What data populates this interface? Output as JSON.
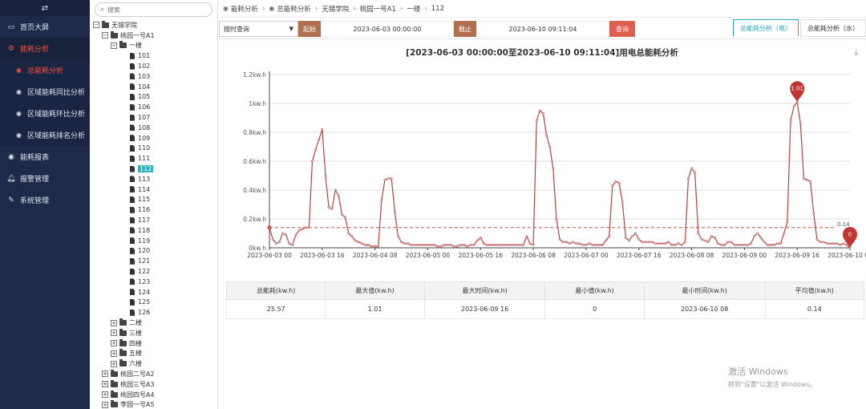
{
  "nav": {
    "items": [
      {
        "label": "首页大屏",
        "icon": "monitor-icon"
      },
      {
        "label": "能耗分析",
        "icon": "gear-icon",
        "active": true,
        "children": [
          {
            "label": "总能耗分析",
            "active": true
          },
          {
            "label": "区域能耗同比分析"
          },
          {
            "label": "区域能耗环比分析"
          },
          {
            "label": "区域能耗排名分析"
          }
        ]
      },
      {
        "label": "能耗报表",
        "icon": "pin-icon"
      },
      {
        "label": "报警管理",
        "icon": "bell-icon"
      },
      {
        "label": "系统管理",
        "icon": "wrench-icon"
      }
    ]
  },
  "tree": {
    "search_placeholder": "搜索",
    "root": "无锡学院",
    "campus": "桃园一号A1",
    "floor1": "一楼",
    "rooms": [
      "101",
      "102",
      "103",
      "104",
      "105",
      "106",
      "107",
      "108",
      "109",
      "110",
      "111",
      "112",
      "113",
      "114",
      "115",
      "116",
      "117",
      "118",
      "119",
      "120",
      "121",
      "122",
      "123",
      "124",
      "125",
      "126"
    ],
    "selected_room": "112",
    "other_floors": [
      "二楼",
      "三楼",
      "四楼",
      "五楼",
      "六楼"
    ],
    "other_buildings": [
      "桃园二号A2",
      "桃园三号A3",
      "桃园四号A4",
      "李园一号A5"
    ]
  },
  "breadcrumb": [
    "能耗分析",
    "总能耗分析",
    "无锡学院",
    "桃园一号A1",
    "一楼",
    "112"
  ],
  "toolbar": {
    "mode": "按时查询",
    "start_label": "起始",
    "start_value": "2023-06-03 00:00:00",
    "end_label": "截止",
    "end_value": "2023-06-10 09:11:04",
    "query_label": "查询",
    "tabs": [
      "总能耗分析（电）",
      "总能耗分析（水）"
    ]
  },
  "colors": {
    "line": "#b8403e",
    "marker": "#c23531",
    "accent": "#2ba3b8",
    "nav_bg": "#1e2a4a"
  },
  "chart_data": {
    "type": "line",
    "title": "[2023-06-03 00:00:00至2023-06-10 09:11:04]用电总能耗分析",
    "y_ticks": [
      "0kw.h",
      "0.2kw.h",
      "0.4kw.h",
      "0.6kw.h",
      "0.8kw.h",
      "1kw.h",
      "1.2kw.h"
    ],
    "ylim": [
      0,
      1.2
    ],
    "x_ticks": [
      "2023-06-03 00",
      "2023-06-03 16",
      "2023-06-04 08",
      "2023-06-05 00",
      "2023-06-05 16",
      "2023-06-06 08",
      "2023-06-07 00",
      "2023-06-07 16",
      "2023-06-08 08",
      "2023-06-09 00",
      "2023-06-09 16",
      "2023-06-10 08"
    ],
    "x_tick_hours": [
      0,
      16,
      32,
      48,
      64,
      80,
      96,
      112,
      128,
      144,
      160,
      176
    ],
    "average": 0.14,
    "average_label": "0.14",
    "max_pin": {
      "label": "1.01",
      "hour": 160,
      "value": 1.01
    },
    "min_pin": {
      "label": "0",
      "hour": 176,
      "value": 0
    },
    "points": [
      [
        0,
        0.14
      ],
      [
        1,
        0.06
      ],
      [
        2,
        0.03
      ],
      [
        3,
        0.04
      ],
      [
        4,
        0.1
      ],
      [
        5,
        0.09
      ],
      [
        6,
        0.03
      ],
      [
        7,
        0.02
      ],
      [
        8,
        0.09
      ],
      [
        9,
        0.12
      ],
      [
        10,
        0.13
      ],
      [
        11,
        0.14
      ],
      [
        12,
        0.14
      ],
      [
        13,
        0.6
      ],
      [
        14,
        0.68
      ],
      [
        15,
        0.75
      ],
      [
        16,
        0.82
      ],
      [
        17,
        0.5
      ],
      [
        18,
        0.28
      ],
      [
        19,
        0.27
      ],
      [
        20,
        0.4
      ],
      [
        21,
        0.36
      ],
      [
        22,
        0.23
      ],
      [
        23,
        0.21
      ],
      [
        24,
        0.1
      ],
      [
        25,
        0.08
      ],
      [
        26,
        0.05
      ],
      [
        27,
        0.04
      ],
      [
        28,
        0.03
      ],
      [
        29,
        0.02
      ],
      [
        30,
        0.02
      ],
      [
        31,
        0.01
      ],
      [
        32,
        0.01
      ],
      [
        33,
        0.01
      ],
      [
        34,
        0.33
      ],
      [
        35,
        0.47
      ],
      [
        36,
        0.48
      ],
      [
        37,
        0.48
      ],
      [
        38,
        0.25
      ],
      [
        39,
        0.08
      ],
      [
        40,
        0.04
      ],
      [
        41,
        0.03
      ],
      [
        42,
        0.03
      ],
      [
        43,
        0.02
      ],
      [
        44,
        0.02
      ],
      [
        45,
        0.02
      ],
      [
        46,
        0.02
      ],
      [
        47,
        0.02
      ],
      [
        48,
        0.02
      ],
      [
        49,
        0.02
      ],
      [
        50,
        0.02
      ],
      [
        51,
        0.01
      ],
      [
        52,
        0.01
      ],
      [
        53,
        0.02
      ],
      [
        54,
        0.02
      ],
      [
        55,
        0.02
      ],
      [
        56,
        0.01
      ],
      [
        57,
        0.01
      ],
      [
        58,
        0.02
      ],
      [
        59,
        0.02
      ],
      [
        60,
        0.01
      ],
      [
        61,
        0.02
      ],
      [
        62,
        0.02
      ],
      [
        63,
        0.05
      ],
      [
        64,
        0.07
      ],
      [
        65,
        0.03
      ],
      [
        66,
        0.02
      ],
      [
        67,
        0.02
      ],
      [
        68,
        0.02
      ],
      [
        69,
        0.02
      ],
      [
        70,
        0.02
      ],
      [
        71,
        0.02
      ],
      [
        72,
        0.02
      ],
      [
        73,
        0.02
      ],
      [
        74,
        0.02
      ],
      [
        75,
        0.02
      ],
      [
        76,
        0.02
      ],
      [
        77,
        0.02
      ],
      [
        78,
        0.08
      ],
      [
        79,
        0.03
      ],
      [
        80,
        0.02
      ],
      [
        81,
        0.88
      ],
      [
        82,
        0.95
      ],
      [
        83,
        0.93
      ],
      [
        84,
        0.78
      ],
      [
        85,
        0.7
      ],
      [
        86,
        0.55
      ],
      [
        87,
        0.2
      ],
      [
        88,
        0.06
      ],
      [
        89,
        0.04
      ],
      [
        90,
        0.04
      ],
      [
        91,
        0.03
      ],
      [
        92,
        0.04
      ],
      [
        93,
        0.03
      ],
      [
        94,
        0.03
      ],
      [
        95,
        0.02
      ],
      [
        96,
        0.02
      ],
      [
        97,
        0.03
      ],
      [
        98,
        0.02
      ],
      [
        99,
        0.02
      ],
      [
        100,
        0.02
      ],
      [
        101,
        0.02
      ],
      [
        102,
        0.05
      ],
      [
        103,
        0.08
      ],
      [
        104,
        0.43
      ],
      [
        105,
        0.46
      ],
      [
        106,
        0.45
      ],
      [
        107,
        0.32
      ],
      [
        108,
        0.07
      ],
      [
        109,
        0.05
      ],
      [
        110,
        0.08
      ],
      [
        111,
        0.1
      ],
      [
        112,
        0.06
      ],
      [
        113,
        0.04
      ],
      [
        114,
        0.04
      ],
      [
        115,
        0.04
      ],
      [
        116,
        0.04
      ],
      [
        117,
        0.03
      ],
      [
        118,
        0.03
      ],
      [
        119,
        0.03
      ],
      [
        120,
        0.03
      ],
      [
        121,
        0.04
      ],
      [
        122,
        0.02
      ],
      [
        123,
        0.02
      ],
      [
        124,
        0.03
      ],
      [
        125,
        0.02
      ],
      [
        126,
        0.04
      ],
      [
        127,
        0.48
      ],
      [
        128,
        0.55
      ],
      [
        129,
        0.52
      ],
      [
        130,
        0.1
      ],
      [
        131,
        0.06
      ],
      [
        132,
        0.05
      ],
      [
        133,
        0.04
      ],
      [
        134,
        0.08
      ],
      [
        135,
        0.07
      ],
      [
        136,
        0.03
      ],
      [
        137,
        0.02
      ],
      [
        138,
        0.02
      ],
      [
        139,
        0.04
      ],
      [
        140,
        0.04
      ],
      [
        141,
        0.02
      ],
      [
        142,
        0.02
      ],
      [
        143,
        0.02
      ],
      [
        144,
        0.02
      ],
      [
        145,
        0.02
      ],
      [
        146,
        0.03
      ],
      [
        147,
        0.08
      ],
      [
        148,
        0.1
      ],
      [
        149,
        0.07
      ],
      [
        150,
        0.04
      ],
      [
        151,
        0.02
      ],
      [
        152,
        0.02
      ],
      [
        153,
        0.02
      ],
      [
        154,
        0.03
      ],
      [
        155,
        0.03
      ],
      [
        156,
        0.1
      ],
      [
        157,
        0.18
      ],
      [
        158,
        0.88
      ],
      [
        159,
        0.98
      ],
      [
        160,
        1.01
      ],
      [
        161,
        0.86
      ],
      [
        162,
        0.48
      ],
      [
        163,
        0.47
      ],
      [
        164,
        0.46
      ],
      [
        165,
        0.24
      ],
      [
        166,
        0.06
      ],
      [
        167,
        0.04
      ],
      [
        168,
        0.04
      ],
      [
        169,
        0.03
      ],
      [
        170,
        0.03
      ],
      [
        171,
        0.03
      ],
      [
        172,
        0.03
      ],
      [
        173,
        0.02
      ],
      [
        174,
        0.03
      ],
      [
        175,
        0.02
      ],
      [
        176,
        0.0
      ]
    ]
  },
  "stats": {
    "headers": [
      "总能耗(kw.h)",
      "最大值(kw.h)",
      "最大时间(kw.h)",
      "最小值(kw.h)",
      "最小时间(kw.h)",
      "平均值(kw.h)"
    ],
    "values": [
      "25.57",
      "1.01",
      "2023-06-09 16",
      "0",
      "2023-06-10 08",
      "0.14"
    ]
  },
  "watermark": {
    "line1": "激活 Windows",
    "line2": "转到\"设置\"以激活 Windows。"
  }
}
